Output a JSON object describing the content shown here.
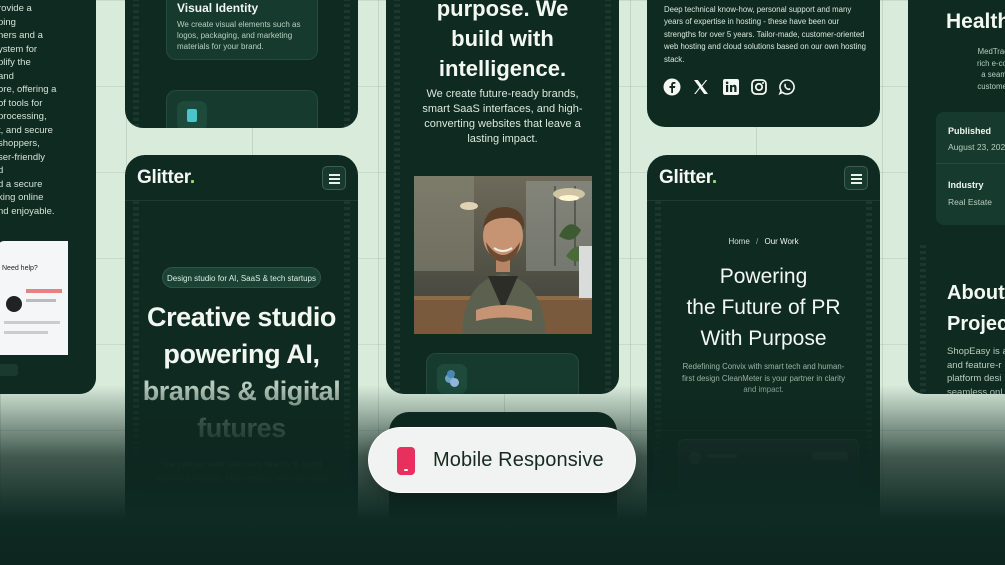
{
  "brand": {
    "logo": "Glitter",
    "logo_dot": "."
  },
  "left_partial": {
    "lines": [
      "rovide a",
      "ping",
      "ners and a",
      "ystem for",
      "plify the",
      "and",
      "ore, offering a",
      "of tools for",
      "processing,",
      "t, and secure",
      "shoppers,",
      "ser-friendly",
      "d",
      "d a secure",
      "king online",
      "nd enjoyable."
    ],
    "chat_preview": "Need help?"
  },
  "card_visual_identity": {
    "title": "Visual Identity",
    "desc_lines": [
      "We create visual elements such as",
      "logos, packaging, and marketing",
      "materials for your brand."
    ]
  },
  "hero_phone": {
    "badge": "Design studio for AI, SaaS & tech startups",
    "heading_lines": [
      "Creative studio",
      "powering AI,",
      "brands & digital",
      "futures"
    ],
    "sub_lines": [
      "We partner with visionary teams to build",
      "standout brands, high-impact websites and"
    ]
  },
  "center_phone": {
    "heading_lines": [
      "purpose. We",
      "build with",
      "intelligence."
    ],
    "body_lines": [
      "We create future-ready brands,",
      "smart SaaS interfaces, and high-",
      "converting websites that leave a",
      "lasting impact."
    ]
  },
  "about_card": {
    "body_lines": [
      "Deep technical know-how, personal support and many",
      "years of expertise in hosting - these have been our",
      "strengths for over 5 years. Tailor-made, customer-oriented",
      "web hosting and cloud solutions based on our own hosting",
      "stack."
    ],
    "social_icons": [
      "facebook-icon",
      "x-icon",
      "linkedin-icon",
      "instagram-icon",
      "whatsapp-icon"
    ]
  },
  "work_phone": {
    "breadcrumb_home": "Home",
    "breadcrumb_sep": "/",
    "breadcrumb_current": "Our Work",
    "heading_lines": [
      "Powering",
      "the Future of PR",
      "With Purpose"
    ],
    "sub_lines": [
      "Redefining Convix with smart tech and human-",
      "first design CleanMeter is your partner in clarity",
      "and impact."
    ]
  },
  "right_partial": {
    "title": "Health",
    "desc_lines": [
      "MedTrack is a m",
      "rich e-commerce",
      "a seamless onli",
      "customers and a"
    ],
    "published_label": "Published",
    "published_value": "August 23, 202",
    "industry_label": "Industry",
    "industry_value": "Real Estate",
    "about_lines": [
      "About",
      "Projec"
    ],
    "about_body": [
      "ShopEasy is a",
      "and feature-r",
      "platform desi",
      "seamless onl"
    ]
  },
  "badge_pill": {
    "label": "Mobile Responsive",
    "icon": "mobile-icon",
    "icon_color": "#e8305f"
  },
  "colors": {
    "panel": "#0f2a21",
    "background": "#d9ecdc",
    "accent": "#9be36b"
  }
}
